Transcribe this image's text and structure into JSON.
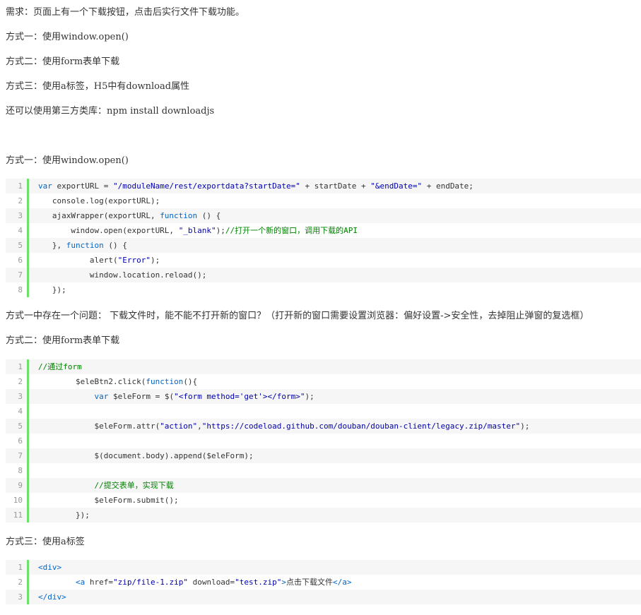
{
  "paragraphs": {
    "requirement": "需求：页面上有一个下载按钮，点击后实行文件下载功能。",
    "method1": "方式一：使用window.open()",
    "method2": "方式二：使用form表单下载",
    "method3": "方式三：使用a标签，H5中有download属性",
    "thirdparty": "还可以使用第三方类库：npm install downloadjs",
    "heading1": "方式一：使用window.open()",
    "issue": "方式一中存在一个问题：    下载文件时，能不能不打开新的窗口？（打开新的窗口需要设置浏览器：偏好设置->安全性，去掉阻止弹窗的复选框）",
    "heading2": "方式二：使用form表单下载",
    "heading3": "方式三：使用a标签"
  },
  "code_blocks": [
    {
      "lines": [
        [
          [
            "kw",
            "var"
          ],
          [
            "t",
            " exportURL = "
          ],
          [
            "str",
            "\"/moduleName/rest/exportdata?startDate=\""
          ],
          [
            "t",
            " + startDate + "
          ],
          [
            "str",
            "\"&endDate=\""
          ],
          [
            "t",
            " + endDate;"
          ]
        ],
        [
          [
            "t",
            "   console.log(exportURL);"
          ]
        ],
        [
          [
            "t",
            "   ajaxWrapper(exportURL, "
          ],
          [
            "kw",
            "function"
          ],
          [
            "t",
            " () {"
          ]
        ],
        [
          [
            "t",
            "       window.open(exportURL, "
          ],
          [
            "str",
            "\"_blank\""
          ],
          [
            "t",
            ");"
          ],
          [
            "cm",
            "//打开一个新的窗口，调用下载的API"
          ]
        ],
        [
          [
            "t",
            "   }, "
          ],
          [
            "kw",
            "function"
          ],
          [
            "t",
            " () {"
          ]
        ],
        [
          [
            "t",
            "           alert("
          ],
          [
            "str",
            "\"Error\""
          ],
          [
            "t",
            ");"
          ]
        ],
        [
          [
            "t",
            "           window.location.reload();"
          ]
        ],
        [
          [
            "t",
            "   });"
          ]
        ]
      ]
    },
    {
      "lines": [
        [
          [
            "cm",
            "//通过form"
          ]
        ],
        [
          [
            "t",
            "        $eleBtn2.click("
          ],
          [
            "kw",
            "function"
          ],
          [
            "t",
            "(){"
          ]
        ],
        [
          [
            "t",
            "            "
          ],
          [
            "kw",
            "var"
          ],
          [
            "t",
            " $eleForm = $("
          ],
          [
            "str",
            "\"<form method='get'></form>\""
          ],
          [
            "t",
            ");"
          ]
        ],
        [
          [
            "t",
            ""
          ]
        ],
        [
          [
            "t",
            "            $eleForm.attr("
          ],
          [
            "str",
            "\"action\""
          ],
          [
            "t",
            ","
          ],
          [
            "str",
            "\"https://codeload.github.com/douban/douban-client/legacy.zip/master\""
          ],
          [
            "t",
            ");"
          ]
        ],
        [
          [
            "t",
            ""
          ]
        ],
        [
          [
            "t",
            "            $(document.body).append($eleForm);"
          ]
        ],
        [
          [
            "t",
            ""
          ]
        ],
        [
          [
            "t",
            "            "
          ],
          [
            "cm",
            "//提交表单，实现下载"
          ]
        ],
        [
          [
            "t",
            "            $eleForm.submit();"
          ]
        ],
        [
          [
            "t",
            "        });"
          ]
        ]
      ]
    },
    {
      "lines": [
        [
          [
            "kw",
            "<div>"
          ]
        ],
        [
          [
            "t",
            "        "
          ],
          [
            "kw",
            "<a"
          ],
          [
            "t",
            " href="
          ],
          [
            "str",
            "\"zip/file-1.zip\""
          ],
          [
            "t",
            " download="
          ],
          [
            "str",
            "\"test.zip\""
          ],
          [
            "kw",
            ">"
          ],
          [
            "t",
            "点击下载文件"
          ],
          [
            "kw",
            "</a>"
          ]
        ],
        [
          [
            "kw",
            "</div>"
          ]
        ]
      ]
    }
  ]
}
